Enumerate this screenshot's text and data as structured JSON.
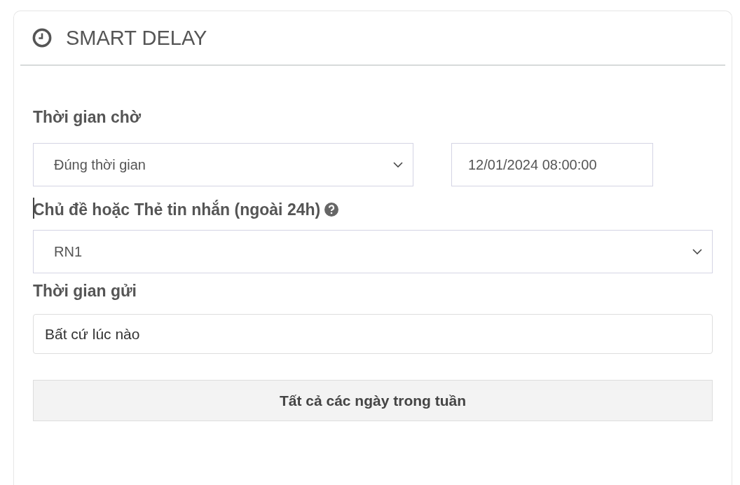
{
  "panel": {
    "title": "SMART DELAY"
  },
  "wait_time": {
    "label": "Thời gian chờ",
    "mode": "Đúng thời gian",
    "datetime": "12/01/2024 08:00:00"
  },
  "topic": {
    "label": "Chủ đề hoặc Thẻ tin nhắn (ngoài 24h)",
    "value": "RN1"
  },
  "send_time": {
    "label": "Thời gian gửi",
    "value": "Bất cứ lúc nào"
  },
  "days_button": "Tất cả các ngày trong tuần"
}
